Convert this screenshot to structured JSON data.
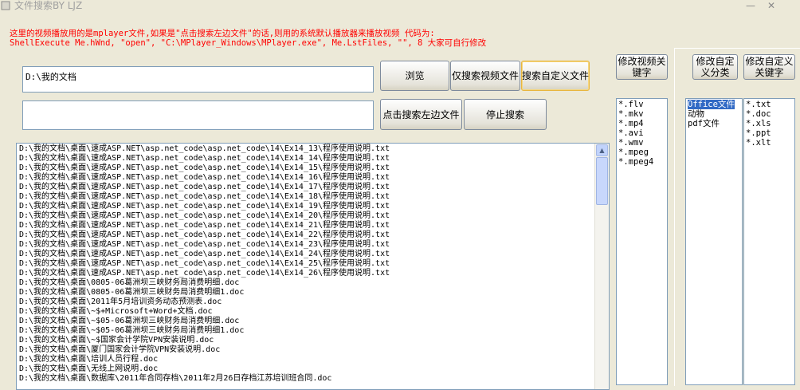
{
  "window": {
    "title": "文件搜索BY LJZ",
    "controls": {
      "minimize": "—",
      "close": "✕"
    }
  },
  "notice": {
    "line1": "这里的视频播放用的是mplayer文件,如果是\"点击搜索左边文件\"的话,则用的系统默认播放器来播放视频 代码为:",
    "line2": "ShellExecute Me.hWnd, \"open\", \"C:\\MPlayer_Windows\\MPlayer.exe\", Me.LstFiles, \"\", 8 大家可自行修改"
  },
  "path_input": {
    "value": "D:\\我的文档"
  },
  "second_input": {
    "value": ""
  },
  "buttons": {
    "browse": "浏览",
    "search_video": "仅搜索视频文件",
    "search_custom": "搜索自定义文件",
    "search_left": "点击搜索左边文件",
    "stop": "停止搜索",
    "edit_video_keywords": "修改视频关键字",
    "edit_custom_category": "修改自定义分类",
    "edit_custom_keywords": "修改自定义关键字"
  },
  "video_extensions": [
    "*.flv",
    "*.mkv",
    "*.mp4",
    "*.avi",
    "*.wmv",
    "*.mpeg",
    "*.mpeg4"
  ],
  "categories": {
    "items": [
      "Office文件",
      "动物",
      "pdf文件"
    ],
    "selected_index": 0
  },
  "category_extensions": [
    "*.txt",
    "*.doc",
    "*.xls",
    "*.ppt",
    "*.xlt"
  ],
  "results": [
    "D:\\我的文档\\桌面\\速成ASP.NET\\asp.net_code\\asp.net_code\\14\\Ex14_13\\程序使用说明.txt",
    "D:\\我的文档\\桌面\\速成ASP.NET\\asp.net_code\\asp.net_code\\14\\Ex14_14\\程序使用说明.txt",
    "D:\\我的文档\\桌面\\速成ASP.NET\\asp.net_code\\asp.net_code\\14\\Ex14_15\\程序使用说明.txt",
    "D:\\我的文档\\桌面\\速成ASP.NET\\asp.net_code\\asp.net_code\\14\\Ex14_16\\程序使用说明.txt",
    "D:\\我的文档\\桌面\\速成ASP.NET\\asp.net_code\\asp.net_code\\14\\Ex14_17\\程序使用说明.txt",
    "D:\\我的文档\\桌面\\速成ASP.NET\\asp.net_code\\asp.net_code\\14\\Ex14_18\\程序使用说明.txt",
    "D:\\我的文档\\桌面\\速成ASP.NET\\asp.net_code\\asp.net_code\\14\\Ex14_19\\程序使用说明.txt",
    "D:\\我的文档\\桌面\\速成ASP.NET\\asp.net_code\\asp.net_code\\14\\Ex14_20\\程序使用说明.txt",
    "D:\\我的文档\\桌面\\速成ASP.NET\\asp.net_code\\asp.net_code\\14\\Ex14_21\\程序使用说明.txt",
    "D:\\我的文档\\桌面\\速成ASP.NET\\asp.net_code\\asp.net_code\\14\\Ex14_22\\程序使用说明.txt",
    "D:\\我的文档\\桌面\\速成ASP.NET\\asp.net_code\\asp.net_code\\14\\Ex14_23\\程序使用说明.txt",
    "D:\\我的文档\\桌面\\速成ASP.NET\\asp.net_code\\asp.net_code\\14\\Ex14_24\\程序使用说明.txt",
    "D:\\我的文档\\桌面\\速成ASP.NET\\asp.net_code\\asp.net_code\\14\\Ex14_25\\程序使用说明.txt",
    "D:\\我的文档\\桌面\\速成ASP.NET\\asp.net_code\\asp.net_code\\14\\Ex14_26\\程序使用说明.txt",
    "D:\\我的文档\\桌面\\0805-06葛洲坝三峡财务局消费明细.doc",
    "D:\\我的文档\\桌面\\0805-06葛洲坝三峡财务局消费明细1.doc",
    "D:\\我的文档\\桌面\\2011年5月培训资务动态预测表.doc",
    "D:\\我的文档\\桌面\\~$+Microsoft+Word+文档.doc",
    "D:\\我的文档\\桌面\\~$05-06葛洲坝三峡财务局消费明细.doc",
    "D:\\我的文档\\桌面\\~$05-06葛洲坝三峡财务局消费明细1.doc",
    "D:\\我的文档\\桌面\\~$国家会计学院VPN安装说明.doc",
    "D:\\我的文档\\桌面\\厦门国家会计学院VPN安装说明.doc",
    "D:\\我的文档\\桌面\\培训人员行程.doc",
    "D:\\我的文档\\桌面\\无线上网说明.doc",
    "D:\\我的文档\\桌面\\数据库\\2011年合同存档\\2011年2月26日存档江苏培训班合同.doc"
  ]
}
